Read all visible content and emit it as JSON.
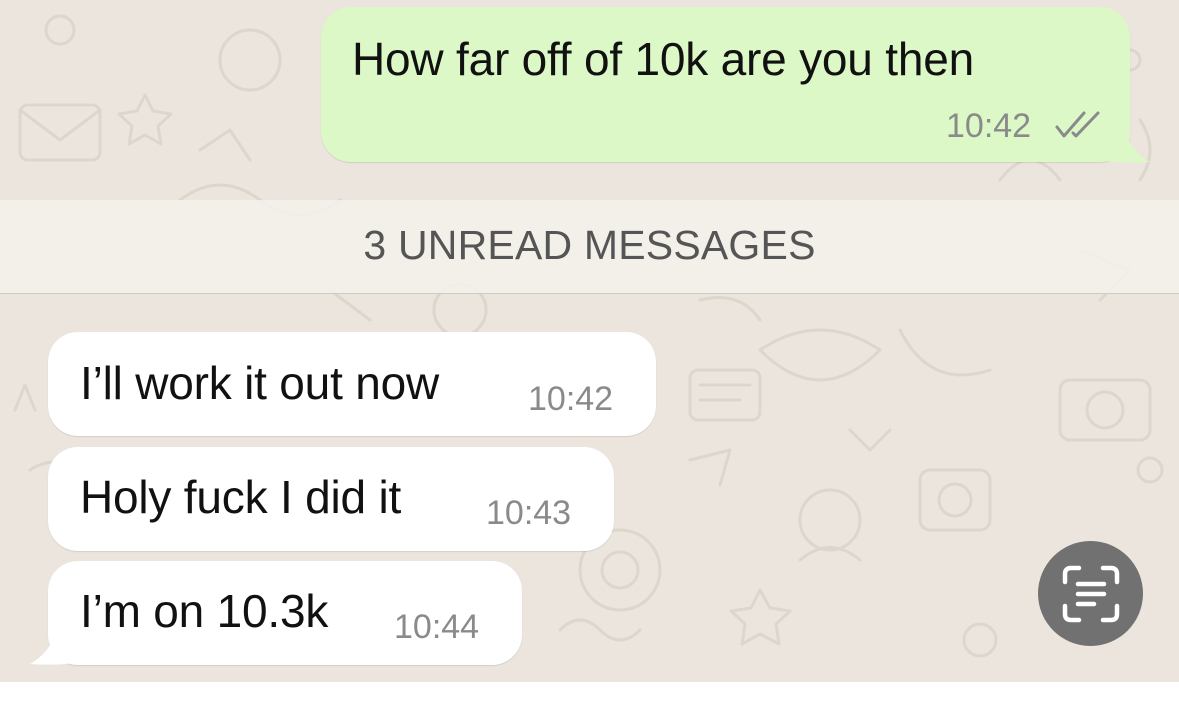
{
  "messages": {
    "outgoing": {
      "text": "How far off of 10k are you then",
      "time": "10:42",
      "status_icon": "double-check-icon"
    },
    "unread_banner": "3 UNREAD MESSAGES",
    "incoming": [
      {
        "text": "I’ll work it out now",
        "time": "10:42"
      },
      {
        "text": "Holy fuck I did it",
        "time": "10:43"
      },
      {
        "text": "I’m on 10.3k",
        "time": "10:44"
      }
    ]
  },
  "overlay": {
    "live_text_button_icon": "scan-text-icon"
  },
  "colors": {
    "chat_background": "#ebe5dd",
    "outgoing_bubble": "#dcf8c6",
    "incoming_bubble": "#ffffff",
    "timestamp": "#8a8a8a",
    "scan_button": "#717171"
  }
}
